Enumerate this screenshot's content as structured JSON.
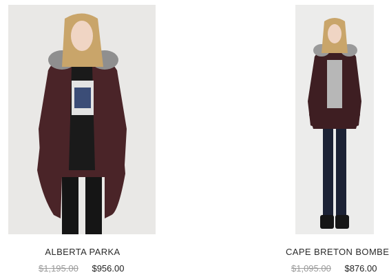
{
  "products": [
    {
      "name": "ALBERTA PARKA",
      "price_original": "$1,195.00",
      "price_sale": "$956.00",
      "colors": {
        "coat": "#4a2428",
        "fur": "#8f8f8f",
        "hair": "#c9a56a",
        "pants": "#151515",
        "background": "#e9e8e6"
      }
    },
    {
      "name": "CAPE BRETON BOMBER",
      "price_original": "$1,095.00",
      "price_sale": "$876.00",
      "colors": {
        "coat": "#3e1e22",
        "fur": "#9a9a9a",
        "hair": "#c9a56a",
        "jeans": "#1c2235",
        "background": "#ececeb"
      }
    }
  ]
}
